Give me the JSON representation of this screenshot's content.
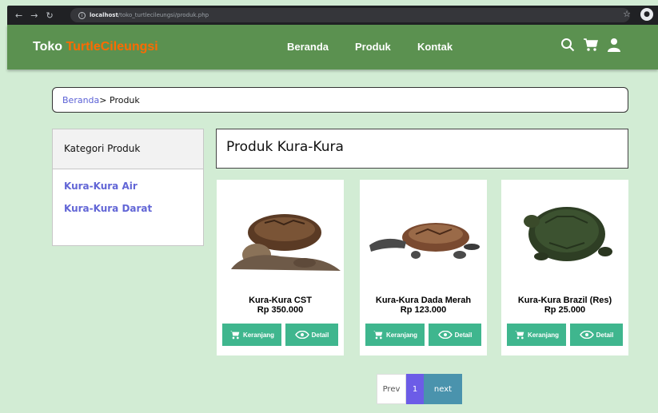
{
  "browser": {
    "url_host": "localhost",
    "url_path": "/toko_turtlecileungsi/produk.php"
  },
  "header": {
    "brand_main": "Toko ",
    "brand_accent": "TurtleCileungsi",
    "menu": [
      "Beranda",
      "Produk",
      "Kontak"
    ]
  },
  "breadcrumb": {
    "home": "Beranda",
    "separator": "> ",
    "current": "Produk"
  },
  "sidebar": {
    "title": "Kategori Produk",
    "items": [
      "Kura-Kura Air",
      "Kura-Kura Darat"
    ]
  },
  "main": {
    "title": "Produk Kura-Kura"
  },
  "products": [
    {
      "name": "Kura-Kura CST",
      "price": "Rp 350.000"
    },
    {
      "name": "Kura-Kura Dada Merah",
      "price": "Rp 123.000"
    },
    {
      "name": "Kura-Kura Brazil (Res)",
      "price": "Rp 25.000"
    }
  ],
  "buttons": {
    "cart": "Keranjang",
    "detail": "Detail"
  },
  "pagination": {
    "prev": "Prev",
    "current": "1",
    "next": "next"
  },
  "colors": {
    "header_bg": "#5b9150",
    "page_bg": "#d2ecd4",
    "brand_accent": "#ff6a00",
    "link": "#5c62d6",
    "button": "#3fb68e",
    "pager_current": "#6c5ce7",
    "pager_next": "#4a93ad"
  }
}
